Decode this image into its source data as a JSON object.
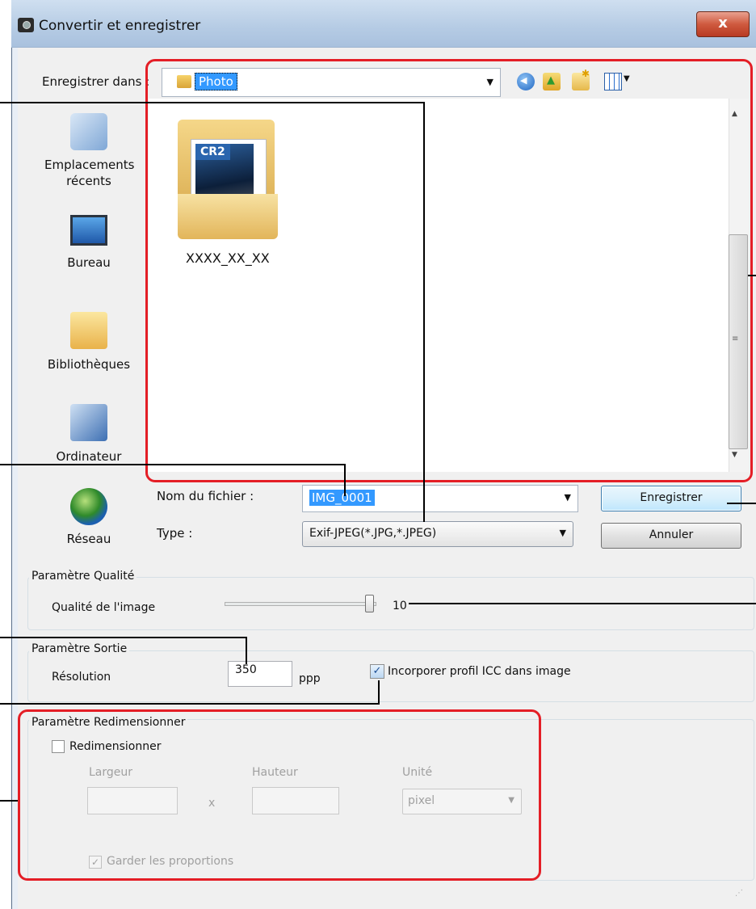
{
  "window": {
    "title": "Convertir et enregistrer",
    "close_label": "x"
  },
  "toolbar": {
    "save_in_label": "Enregistrer dans :",
    "folder": "Photo"
  },
  "sidebar": {
    "items": [
      {
        "label": "Emplacements récents",
        "icon": "recent-places-icon"
      },
      {
        "label": "Bureau",
        "icon": "desktop-icon"
      },
      {
        "label": "Bibliothèques",
        "icon": "libraries-icon"
      },
      {
        "label": "Ordinateur",
        "icon": "computer-icon"
      },
      {
        "label": "Réseau",
        "icon": "network-icon"
      }
    ]
  },
  "files": [
    {
      "name": "XXXX_XX_XX",
      "badge": "CR2"
    }
  ],
  "form": {
    "filename_label": "Nom du fichier :",
    "filename_value": "IMG_0001",
    "type_label": "Type :",
    "type_value": "Exif-JPEG(*.JPG,*.JPEG)",
    "save_button": "Enregistrer",
    "cancel_button": "Annuler"
  },
  "quality": {
    "title": "Paramètre Qualité",
    "label": "Qualité de l'image",
    "value": "10",
    "level": 10,
    "max": 10
  },
  "output": {
    "title": "Paramètre Sortie",
    "resolution_label": "Résolution",
    "resolution_value": "350",
    "unit": "ppp",
    "icc_label": "Incorporer profil ICC dans image",
    "icc_checked": true
  },
  "resize": {
    "title": "Paramètre Redimensionner",
    "checkbox_label": "Redimensionner",
    "checked": false,
    "width_label": "Largeur",
    "height_label": "Hauteur",
    "unit_label": "Unité",
    "separator": "x",
    "unit_value": "pixel",
    "keep_label": "Garder les proportions",
    "keep_checked": true
  },
  "colors": {
    "accent": "#3399ff",
    "highlight": "#e41e26"
  }
}
